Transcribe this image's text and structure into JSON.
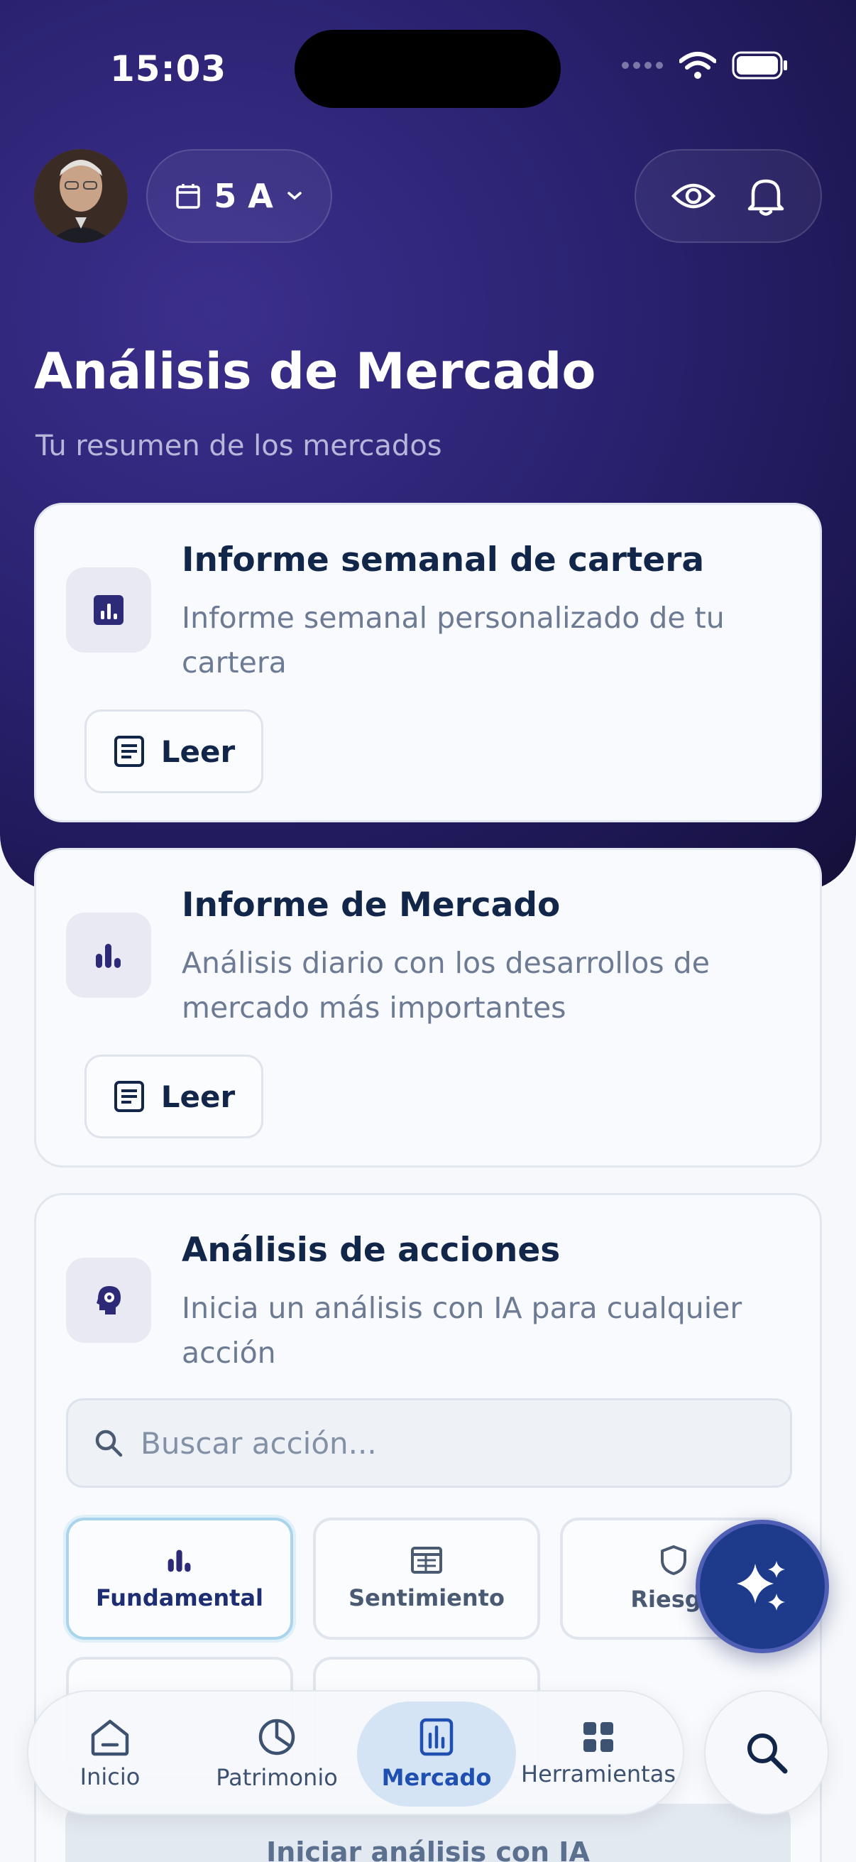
{
  "status_bar": {
    "time": "15:03"
  },
  "header": {
    "period_label": "5 A"
  },
  "page": {
    "title": "Análisis de Mercado",
    "subtitle": "Tu resumen de los mercados"
  },
  "cards": [
    {
      "title": "Informe semanal de cartera",
      "description": "Informe semanal personalizado de tu cartera",
      "button": "Leer",
      "icon": "bar-chart-square-icon"
    },
    {
      "title": "Informe de Mercado",
      "description": "Análisis diario con los desarrollos de mercado más importantes",
      "button": "Leer",
      "icon": "bar-chart-icon"
    },
    {
      "title": "Análisis de acciones",
      "description": "Inicia un análisis con IA para cualquier acción",
      "icon": "ai-brain-icon"
    }
  ],
  "stock_search": {
    "placeholder": "Buscar acción..."
  },
  "analysis_types": [
    {
      "label": "Fundamental",
      "icon": "bar-chart-icon",
      "active": true
    },
    {
      "label": "Sentimiento",
      "icon": "newspaper-icon",
      "active": false
    },
    {
      "label": "Riesgo",
      "icon": "shield-icon",
      "active": false
    }
  ],
  "cta": {
    "label": "Iniciar análisis con IA"
  },
  "tabbar": [
    {
      "label": "Inicio",
      "icon": "home-icon"
    },
    {
      "label": "Patrimonio",
      "icon": "pie-chart-icon"
    },
    {
      "label": "Mercado",
      "icon": "market-chart-icon",
      "active": true
    },
    {
      "label": "Herramientas",
      "icon": "grid-icon"
    }
  ],
  "colors": {
    "hero_bg": "#2a2270",
    "accent": "#1e3a8a",
    "active_tab_bg": "#d5e4f4",
    "text_primary": "#12264a"
  }
}
